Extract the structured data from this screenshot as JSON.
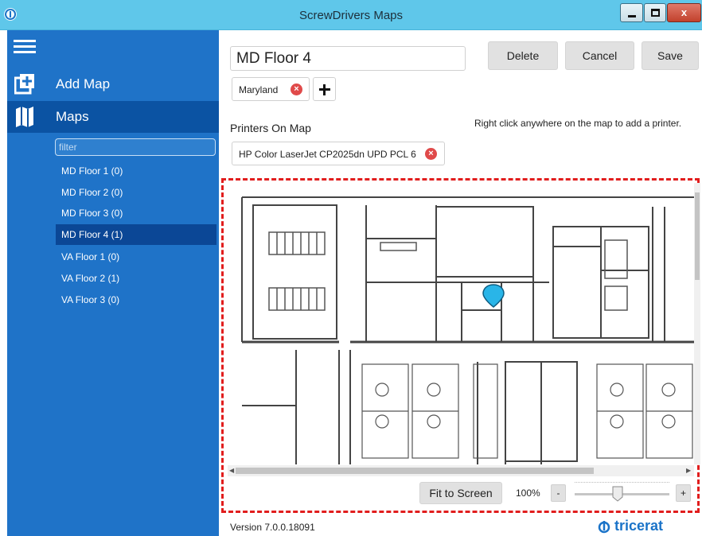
{
  "window": {
    "title": "ScrewDrivers Maps",
    "controls": {
      "minimize": "–",
      "maximize": "□",
      "close": "x"
    }
  },
  "sidebar": {
    "menu_icon": "hamburger-icon",
    "add_map": {
      "label": "Add Map",
      "icon": "add-map-icon"
    },
    "maps": {
      "label": "Maps",
      "icon": "map-icon"
    },
    "filter_placeholder": "filter",
    "items": [
      {
        "label": "MD Floor 1 (0)"
      },
      {
        "label": "MD Floor 2 (0)"
      },
      {
        "label": "MD Floor 3 (0)"
      },
      {
        "label": "MD Floor 4 (1)",
        "selected": true
      },
      {
        "label": "VA Floor 1 (0)"
      },
      {
        "label": "VA Floor 2 (1)"
      },
      {
        "label": "VA Floor 3 (0)"
      }
    ]
  },
  "editor": {
    "map_name": "MD Floor 4",
    "buttons": {
      "delete": "Delete",
      "cancel": "Cancel",
      "save": "Save"
    },
    "tags": [
      {
        "label": "Maryland"
      }
    ],
    "add_tag_icon": "plus-icon",
    "hint": "Right click anywhere on the map to add a printer.",
    "printers_label": "Printers On Map",
    "printers": [
      {
        "label": "HP Color LaserJet CP2025dn UPD PCL 6"
      }
    ]
  },
  "map_view": {
    "pin_icon": "printer-pin-icon",
    "fit_label": "Fit to Screen",
    "zoom": "100%",
    "zoom_minus": "-",
    "zoom_plus": "+",
    "zoom_level": 0.45
  },
  "footer": {
    "version": "Version 7.0.0.18091",
    "brand": "tricerat"
  },
  "colors": {
    "titlebar": "#5fc7ea",
    "sidebar": "#1f73c8",
    "sidebar_active": "#0b53a3",
    "selected_item": "#0b4796",
    "frame": "#e11d1d",
    "remove_badge": "#e04a4a",
    "pin": "#29b5e8",
    "brand": "#1a73c8"
  }
}
